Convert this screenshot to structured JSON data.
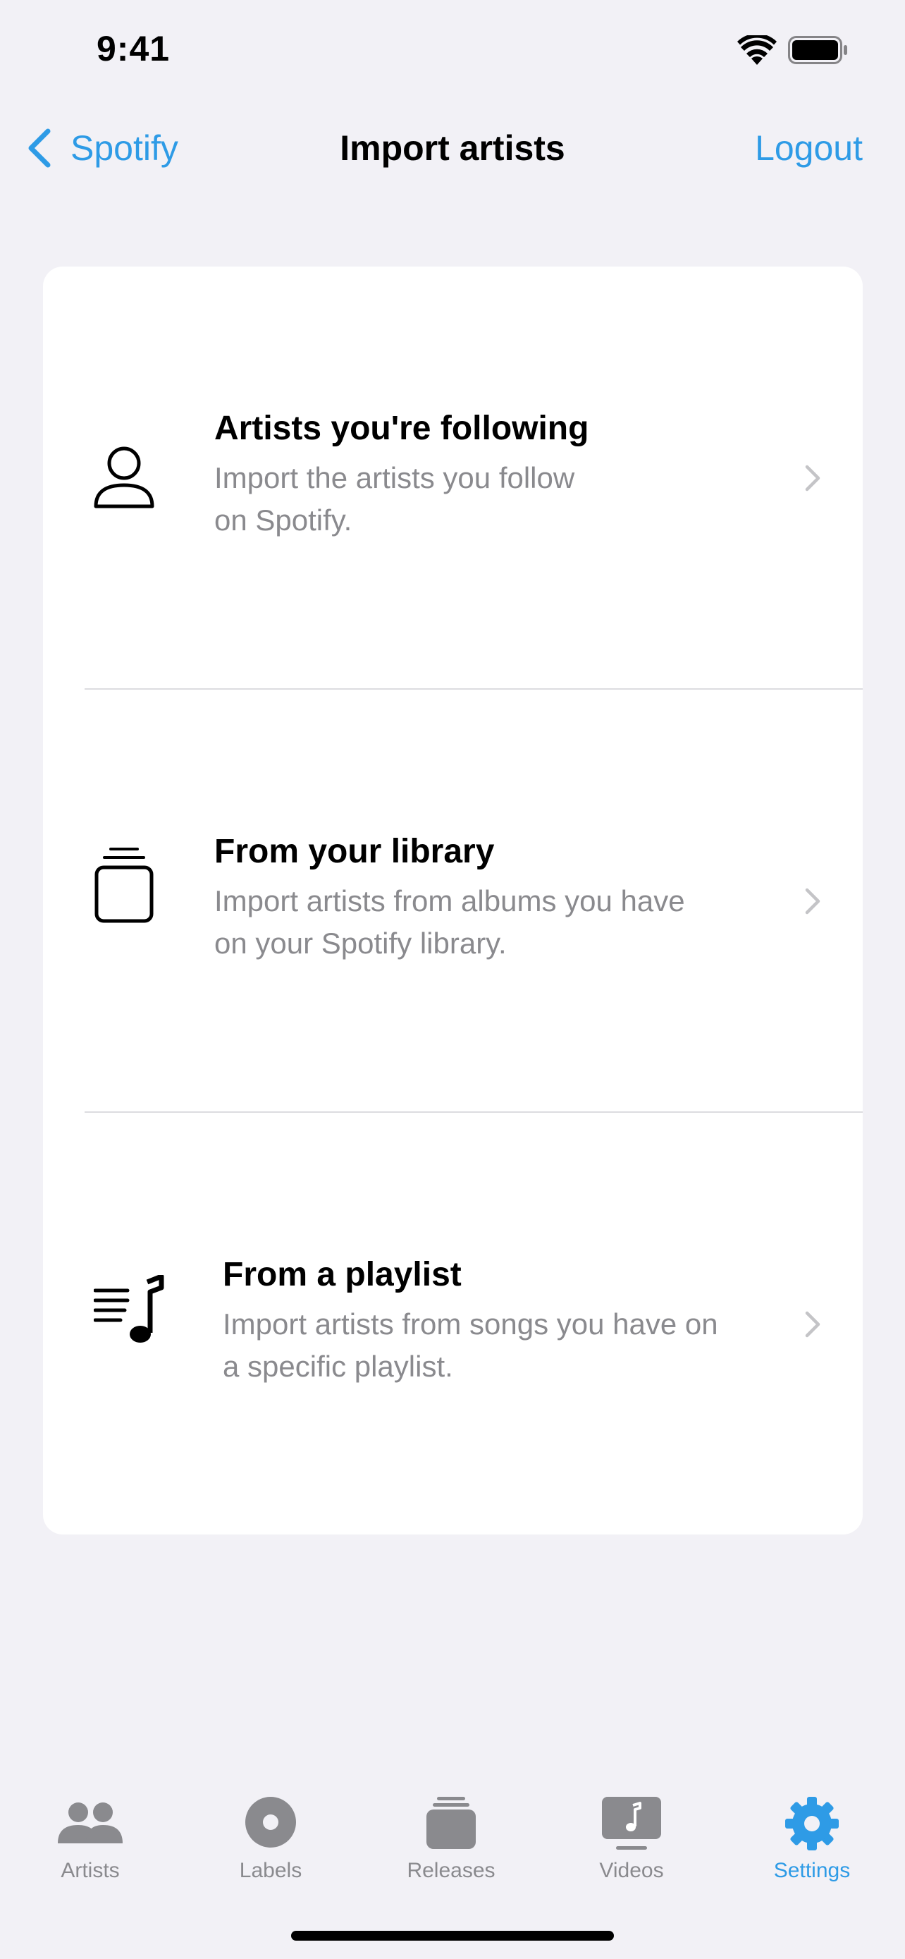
{
  "status_bar": {
    "time": "9:41",
    "wifi_icon": "wifi-icon",
    "battery_icon": "battery-icon"
  },
  "nav": {
    "back_label": "Spotify",
    "back_icon": "chevron-left-icon",
    "title": "Import artists",
    "logout_label": "Logout"
  },
  "options": [
    {
      "icon": "person-icon",
      "title": "Artists you're following",
      "subtitle_line1": "Import the artists you follow",
      "subtitle_line2": "on Spotify."
    },
    {
      "icon": "library-stack-icon",
      "title": "From your library",
      "subtitle_line1": "Import artists from albums you have",
      "subtitle_line2": "on your Spotify library."
    },
    {
      "icon": "music-playlist-icon",
      "title": "From a playlist",
      "subtitle_line1": "Import artists from songs you have on",
      "subtitle_line2": "a specific playlist."
    }
  ],
  "tabs": [
    {
      "label": "Artists",
      "icon": "people-icon",
      "active": false
    },
    {
      "label": "Labels",
      "icon": "record-icon",
      "active": false
    },
    {
      "label": "Releases",
      "icon": "stack-icon",
      "active": false
    },
    {
      "label": "Videos",
      "icon": "music-video-icon",
      "active": false
    },
    {
      "label": "Settings",
      "icon": "gear-icon",
      "active": true
    }
  ],
  "colors": {
    "accent": "#2E9BE6",
    "background": "#F2F1F6",
    "card": "#FFFFFF",
    "secondary_text": "#8A8A8E",
    "inactive_tab": "#8A8A8E"
  }
}
